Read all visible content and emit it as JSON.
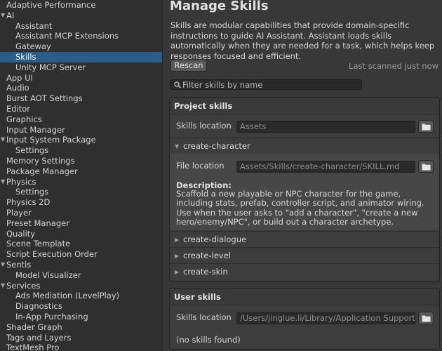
{
  "sidebar": {
    "items": [
      {
        "label": "Adaptive Performance",
        "level": 0,
        "expandable": false
      },
      {
        "label": "AI",
        "level": 0,
        "expandable": true
      },
      {
        "label": "Assistant",
        "level": 1
      },
      {
        "label": "Assistant MCP Extensions",
        "level": 1
      },
      {
        "label": "Gateway",
        "level": 1
      },
      {
        "label": "Skills",
        "level": 1,
        "selected": true
      },
      {
        "label": "Unity MCP Server",
        "level": 1
      },
      {
        "label": "App UI",
        "level": 0
      },
      {
        "label": "Audio",
        "level": 0
      },
      {
        "label": "Burst AOT Settings",
        "level": 0
      },
      {
        "label": "Editor",
        "level": 0
      },
      {
        "label": "Graphics",
        "level": 0
      },
      {
        "label": "Input Manager",
        "level": 0
      },
      {
        "label": "Input System Package",
        "level": 0,
        "expandable": true
      },
      {
        "label": "Settings",
        "level": 1
      },
      {
        "label": "Memory Settings",
        "level": 0
      },
      {
        "label": "Package Manager",
        "level": 0
      },
      {
        "label": "Physics",
        "level": 0,
        "expandable": true
      },
      {
        "label": "Settings",
        "level": 1
      },
      {
        "label": "Physics 2D",
        "level": 0
      },
      {
        "label": "Player",
        "level": 0
      },
      {
        "label": "Preset Manager",
        "level": 0
      },
      {
        "label": "Quality",
        "level": 0
      },
      {
        "label": "Scene Template",
        "level": 0
      },
      {
        "label": "Script Execution Order",
        "level": 0
      },
      {
        "label": "Sentis",
        "level": 0,
        "expandable": true
      },
      {
        "label": "Model Visualizer",
        "level": 1
      },
      {
        "label": "Services",
        "level": 0,
        "expandable": true
      },
      {
        "label": "Ads Mediation (LevelPlay)",
        "level": 1
      },
      {
        "label": "Diagnostics",
        "level": 1
      },
      {
        "label": "In-App Purchasing",
        "level": 1
      },
      {
        "label": "Shader Graph",
        "level": 0
      },
      {
        "label": "Tags and Layers",
        "level": 0
      },
      {
        "label": "TextMesh Pro",
        "level": 0
      }
    ]
  },
  "main": {
    "title": "Manage Skills",
    "description": "Skills are modular capabilities that provide domain-specific instructions to guide AI Assistant. Assistant loads skills automatically when they are needed for a task, which helps keep responses focused and efficient.",
    "rescan_label": "Rescan",
    "last_scanned": "Last scanned just now",
    "filter_placeholder": "Filter skills by name",
    "project_skills": {
      "header": "Project skills",
      "location_label": "Skills location",
      "location_value": "Assets",
      "expanded_skill": {
        "name": "create-character",
        "file_location_label": "File location",
        "file_location_value": "Assets/Skills/create-character/SKILL.md",
        "description_heading": "Description:",
        "description": "Scaffold a new playable or NPC character for the game, including stats, prefab, controller script, and animator wiring. Use when the user asks to \"add a character\", \"create a new hero/enemy/NPC\", or build out a character archetype."
      },
      "collapsed_skills": [
        "create-dialogue",
        "create-level",
        "create-skin"
      ]
    },
    "user_skills": {
      "header": "User skills",
      "location_label": "Skills location",
      "location_value": "/Users/jinglue.li/Library/Application Support/Uni",
      "empty_text": "(no skills found)"
    }
  }
}
